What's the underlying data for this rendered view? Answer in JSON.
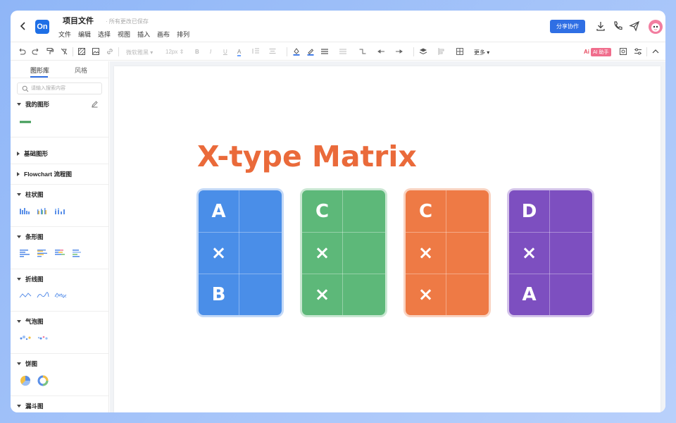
{
  "header": {
    "file_title": "项目文件",
    "save_status": "所有更改已保存",
    "logo_text": "On",
    "menu": [
      "文件",
      "编辑",
      "选择",
      "视图",
      "插入",
      "画布",
      "排列"
    ],
    "share_label": "分享协作"
  },
  "toolbar": {
    "font_family": "微软雅黑",
    "font_size": "12px",
    "more_label": "更多",
    "ai_logo": "Ai",
    "ai_label": "AI 助手"
  },
  "sidebar": {
    "tabs": [
      "图形库",
      "风格"
    ],
    "search_placeholder": "请输入搜索内容",
    "sections": [
      {
        "title": "我的图形"
      },
      {
        "title": "基础图形"
      },
      {
        "title": "Flowchart 流程图"
      },
      {
        "title": "柱状图"
      },
      {
        "title": "条形图"
      },
      {
        "title": "折线图"
      },
      {
        "title": "气泡图"
      },
      {
        "title": "饼图"
      },
      {
        "title": "漏斗图"
      }
    ]
  },
  "canvas": {
    "title": "X-type Matrix",
    "cards": [
      {
        "color": "#4a8ee8",
        "cells": [
          "A",
          "×",
          "B"
        ]
      },
      {
        "color": "#5db879",
        "cells": [
          "C",
          "×",
          "×"
        ]
      },
      {
        "color": "#ee7a45",
        "cells": [
          "C",
          "×",
          "×"
        ]
      },
      {
        "color": "#7d4fc0",
        "cells": [
          "D",
          "×",
          "A"
        ]
      }
    ]
  },
  "colors": {
    "accent": "#2f6fe4",
    "title_orange": "#ea6a3a"
  }
}
